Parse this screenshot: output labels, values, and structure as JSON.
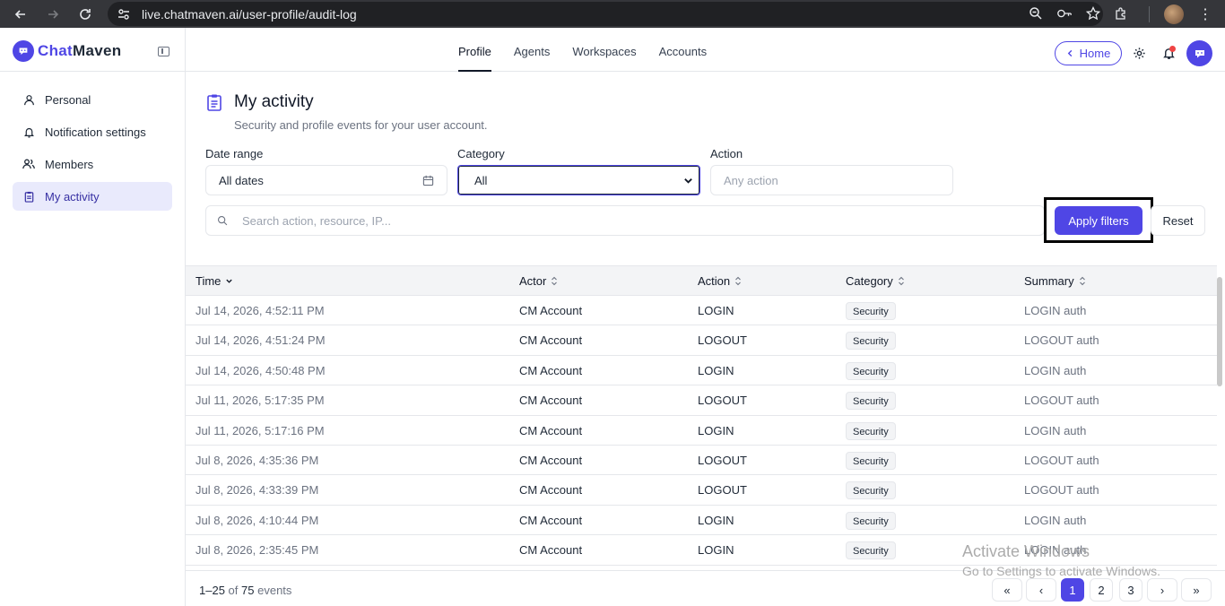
{
  "browser": {
    "url": "live.chatmaven.ai/user-profile/audit-log"
  },
  "brand": {
    "name_part1": "Chat",
    "name_part2": "Maven"
  },
  "top_tabs": [
    {
      "label": "Profile",
      "active": true
    },
    {
      "label": "Agents",
      "active": false
    },
    {
      "label": "Workspaces",
      "active": false
    },
    {
      "label": "Accounts",
      "active": false
    }
  ],
  "header": {
    "home_label": "Home"
  },
  "sidebar": {
    "items": [
      {
        "label": "Personal",
        "icon": "user-icon"
      },
      {
        "label": "Notification settings",
        "icon": "bell-icon"
      },
      {
        "label": "Members",
        "icon": "users-icon"
      },
      {
        "label": "My activity",
        "icon": "clipboard-icon",
        "active": true
      }
    ]
  },
  "page": {
    "title": "My activity",
    "subtitle": "Security and profile events for your user account."
  },
  "filters": {
    "date_range_label": "Date range",
    "date_range_value": "All dates",
    "category_label": "Category",
    "category_value": "All",
    "action_label": "Action",
    "action_placeholder": "Any action",
    "search_placeholder": "Search action, resource, IP...",
    "apply_label": "Apply filters",
    "reset_label": "Reset"
  },
  "table": {
    "columns": [
      "Time",
      "Actor",
      "Action",
      "Category",
      "Summary"
    ],
    "rows": [
      {
        "time": "Jul 14, 2026, 4:52:11 PM",
        "actor": "CM Account",
        "action": "LOGIN",
        "category": "Security",
        "summary": "LOGIN auth"
      },
      {
        "time": "Jul 14, 2026, 4:51:24 PM",
        "actor": "CM Account",
        "action": "LOGOUT",
        "category": "Security",
        "summary": "LOGOUT auth"
      },
      {
        "time": "Jul 14, 2026, 4:50:48 PM",
        "actor": "CM Account",
        "action": "LOGIN",
        "category": "Security",
        "summary": "LOGIN auth"
      },
      {
        "time": "Jul 11, 2026, 5:17:35 PM",
        "actor": "CM Account",
        "action": "LOGOUT",
        "category": "Security",
        "summary": "LOGOUT auth"
      },
      {
        "time": "Jul 11, 2026, 5:17:16 PM",
        "actor": "CM Account",
        "action": "LOGIN",
        "category": "Security",
        "summary": "LOGIN auth"
      },
      {
        "time": "Jul 8, 2026, 4:35:36 PM",
        "actor": "CM Account",
        "action": "LOGOUT",
        "category": "Security",
        "summary": "LOGOUT auth"
      },
      {
        "time": "Jul 8, 2026, 4:33:39 PM",
        "actor": "CM Account",
        "action": "LOGOUT",
        "category": "Security",
        "summary": "LOGOUT auth"
      },
      {
        "time": "Jul 8, 2026, 4:10:44 PM",
        "actor": "CM Account",
        "action": "LOGIN",
        "category": "Security",
        "summary": "LOGIN auth"
      },
      {
        "time": "Jul 8, 2026, 2:35:45 PM",
        "actor": "CM Account",
        "action": "LOGIN",
        "category": "Security",
        "summary": "LOGIN auth"
      }
    ]
  },
  "pagination": {
    "range": "1–25",
    "of_text": "of",
    "total": "75",
    "suffix": "events",
    "first": "«",
    "prev": "‹",
    "next": "›",
    "last": "»",
    "pages": [
      "1",
      "2",
      "3"
    ],
    "current_page": "1"
  },
  "watermark": {
    "line1": "Activate Windows",
    "line2": "Go to Settings to activate Windows."
  },
  "colors": {
    "accent": "#4f46e5",
    "sidebar_active_bg": "#e9eafc",
    "notification_dot": "#ef4444"
  }
}
